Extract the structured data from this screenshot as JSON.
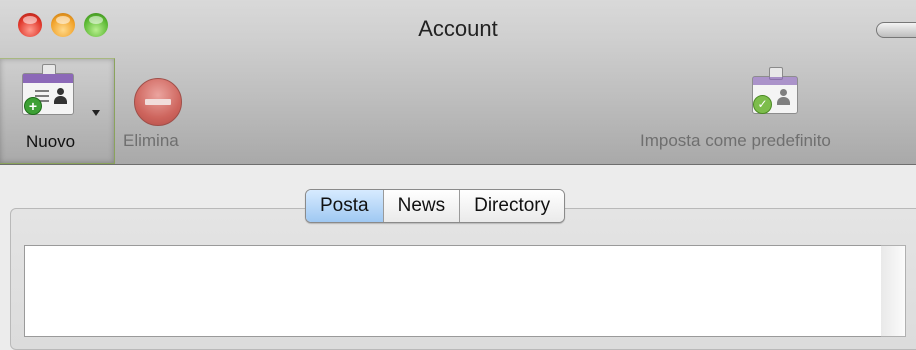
{
  "window": {
    "title": "Account"
  },
  "toolbar": {
    "new_label": "Nuovo",
    "delete_label": "Elimina",
    "set_default_label": "Imposta come predefinito"
  },
  "tabs": [
    {
      "label": "Posta",
      "active": true
    },
    {
      "label": "News",
      "active": false
    },
    {
      "label": "Directory",
      "active": false
    }
  ],
  "icons": {
    "new": "new-account-badge-icon",
    "delete": "delete-minus-icon",
    "set_default": "default-account-badge-icon"
  },
  "colors": {
    "active_tab": "#9fc8f2",
    "badge_band": "#8c69b8"
  }
}
